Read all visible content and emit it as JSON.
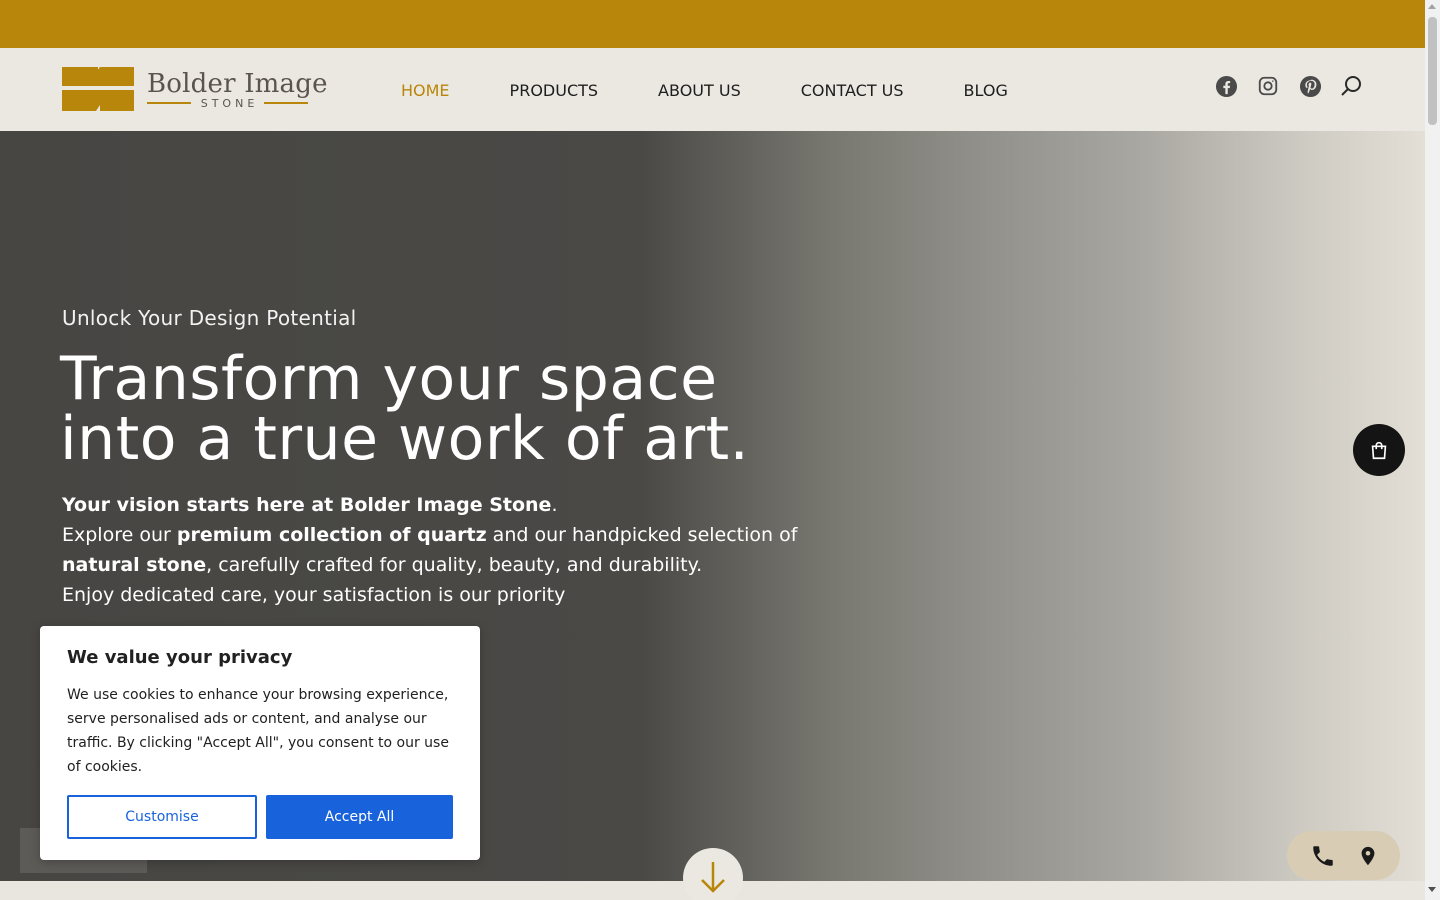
{
  "brand": {
    "name": "Bolder Image",
    "sub": "STONE",
    "accent_color": "#b8860b"
  },
  "nav": {
    "items": [
      {
        "label": "HOME",
        "active": true
      },
      {
        "label": "PRODUCTS",
        "active": false
      },
      {
        "label": "ABOUT US",
        "active": false
      },
      {
        "label": "CONTACT US",
        "active": false
      },
      {
        "label": "BLOG",
        "active": false
      }
    ]
  },
  "header_icons": [
    "facebook-icon",
    "instagram-icon",
    "pinterest-icon",
    "search-icon"
  ],
  "hero": {
    "eyebrow": "Unlock Your Design Potential",
    "headline_line1": "Transform your space",
    "headline_line2": "into a true work of art.",
    "p1_bold": "Your vision starts here at Bolder Image Stone",
    "p1_end": ".",
    "p2_a": "Explore our ",
    "p2_bold": "premium collection of quartz",
    "p2_b": " and our handpicked selection of",
    "p3_bold": "natural stone",
    "p3_rest": ", carefully crafted for quality, beauty, and durability.",
    "p4": "Enjoy dedicated care, your satisfaction is our priority"
  },
  "floating": {
    "cart_icon": "shopping-bag-icon",
    "contact_icons": [
      "phone-icon",
      "location-pin-icon"
    ],
    "scroll_icon": "arrow-down-icon"
  },
  "cookie": {
    "title": "We value your privacy",
    "body": "We use cookies to enhance your browsing experience, serve personalised ads or content, and analyse our traffic. By clicking \"Accept All\", you consent to our use of cookies.",
    "customise_label": "Customise",
    "accept_label": "Accept All",
    "button_color": "#1863dc"
  }
}
